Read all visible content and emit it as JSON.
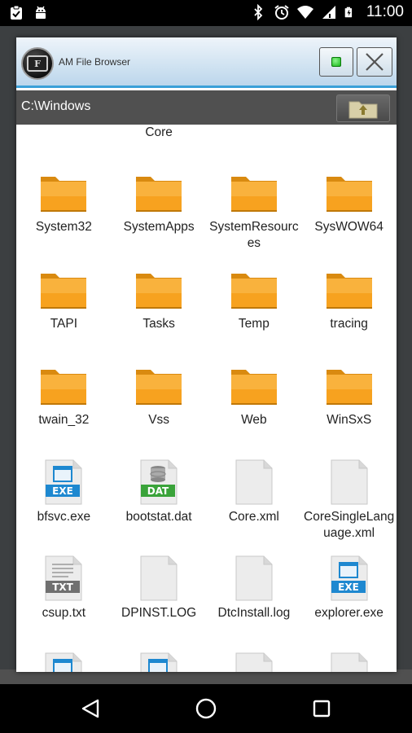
{
  "status_bar": {
    "time": "11:00",
    "icons": [
      "clipboard-check-icon",
      "android-icon",
      "bluetooth-icon",
      "alarm-icon",
      "wifi-icon",
      "signal-icon",
      "battery-icon"
    ]
  },
  "window": {
    "title": "AM File Browser",
    "logo_letter": "F",
    "path": "C:\\Windows"
  },
  "files": [
    {
      "name": "Core",
      "type": "partial-label"
    },
    {
      "name": "System32",
      "type": "folder"
    },
    {
      "name": "SystemApps",
      "type": "folder"
    },
    {
      "name": "SystemResources",
      "type": "folder"
    },
    {
      "name": "SysWOW64",
      "type": "folder"
    },
    {
      "name": "TAPI",
      "type": "folder"
    },
    {
      "name": "Tasks",
      "type": "folder"
    },
    {
      "name": "Temp",
      "type": "folder"
    },
    {
      "name": "tracing",
      "type": "folder"
    },
    {
      "name": "twain_32",
      "type": "folder"
    },
    {
      "name": "Vss",
      "type": "folder"
    },
    {
      "name": "Web",
      "type": "folder"
    },
    {
      "name": "WinSxS",
      "type": "folder"
    },
    {
      "name": "bfsvc.exe",
      "type": "file",
      "badge": "EXE"
    },
    {
      "name": "bootstat.dat",
      "type": "file",
      "badge": "DAT"
    },
    {
      "name": "Core.xml",
      "type": "file",
      "badge": ""
    },
    {
      "name": "CoreSingleLanguage.xml",
      "type": "file",
      "badge": ""
    },
    {
      "name": "csup.txt",
      "type": "file",
      "badge": "TXT"
    },
    {
      "name": "DPINST.LOG",
      "type": "file",
      "badge": ""
    },
    {
      "name": "DtcInstall.log",
      "type": "file",
      "badge": ""
    },
    {
      "name": "explorer.exe",
      "type": "file",
      "badge": "EXE"
    },
    {
      "name": "",
      "type": "file",
      "badge": "EXE"
    },
    {
      "name": "",
      "type": "file",
      "badge": "EXE"
    },
    {
      "name": "",
      "type": "file",
      "badge": ""
    },
    {
      "name": "",
      "type": "file",
      "badge": ""
    }
  ],
  "colors": {
    "folder": "#f7a21f",
    "exe_badge": "#1e88d0",
    "dat_badge": "#3aa33a",
    "txt_badge": "#707070",
    "title_accent": "#3aa0d8"
  }
}
